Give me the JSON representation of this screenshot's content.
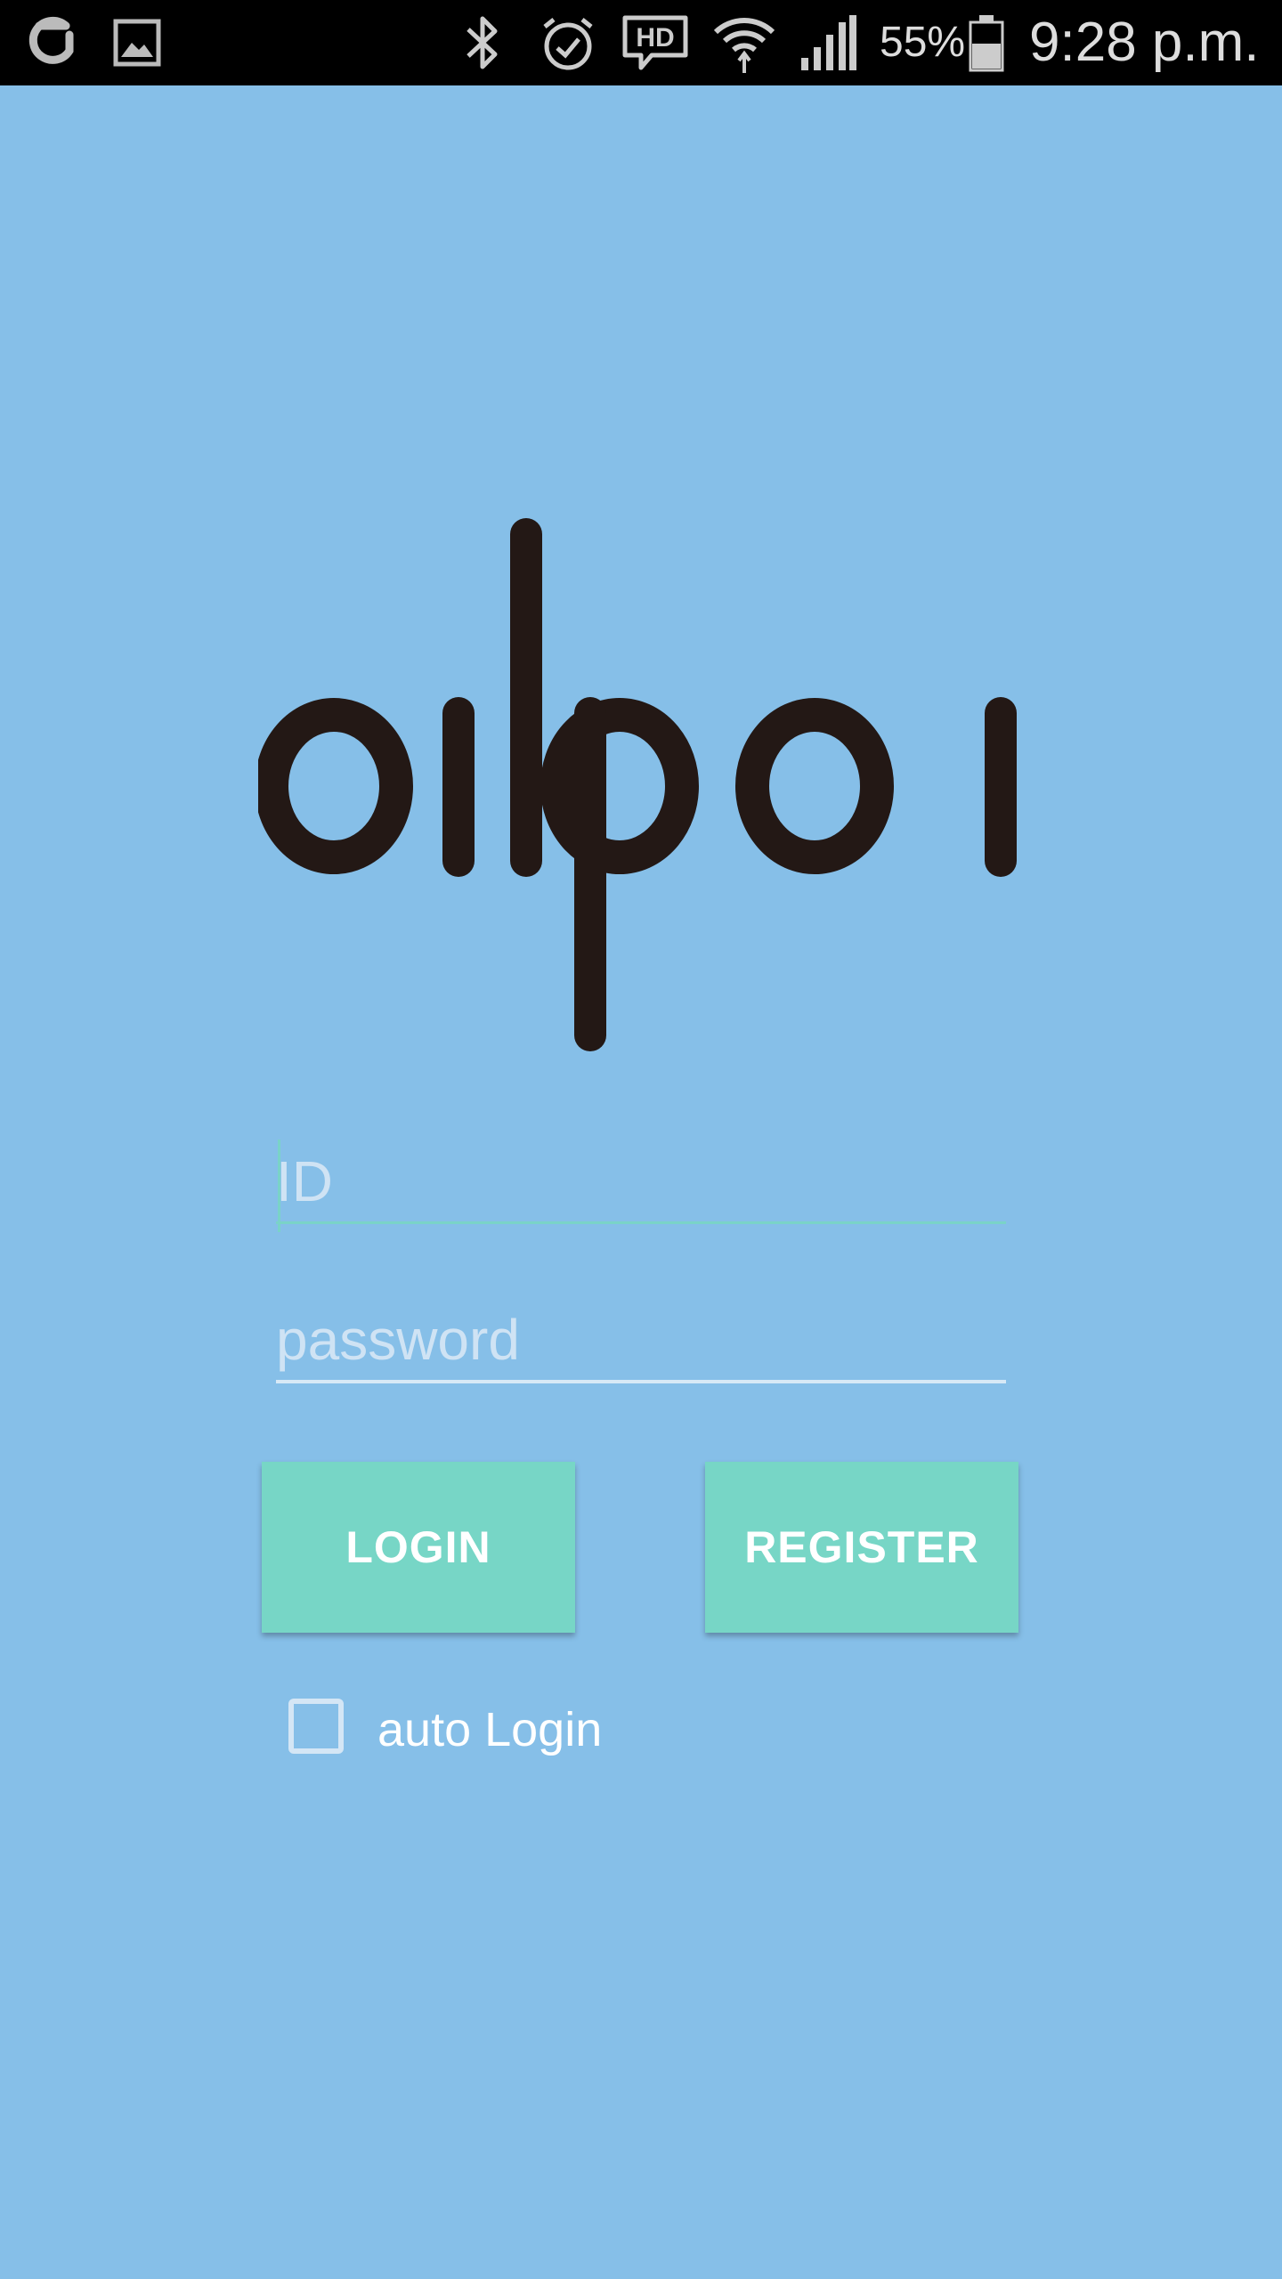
{
  "status_bar": {
    "battery_percent": "55%",
    "time": "9:28 p.m.",
    "icons": [
      "app-g-icon",
      "gallery-icon",
      "bluetooth-icon",
      "alarm-icon",
      "hd-voice-icon",
      "wifi-icon",
      "signal-icon",
      "battery-icon"
    ]
  },
  "logo": {
    "name": "oilpol-logo"
  },
  "login_form": {
    "id_placeholder": "ID",
    "id_value": "",
    "password_placeholder": "password",
    "password_value": "",
    "login_label": "LOGIN",
    "register_label": "REGISTER",
    "auto_login_label": "auto Login",
    "auto_login_checked": false
  },
  "colors": {
    "background": "#86bfe8",
    "button": "#77d6c6",
    "logo": "#231815",
    "status_bar": "#000000"
  }
}
